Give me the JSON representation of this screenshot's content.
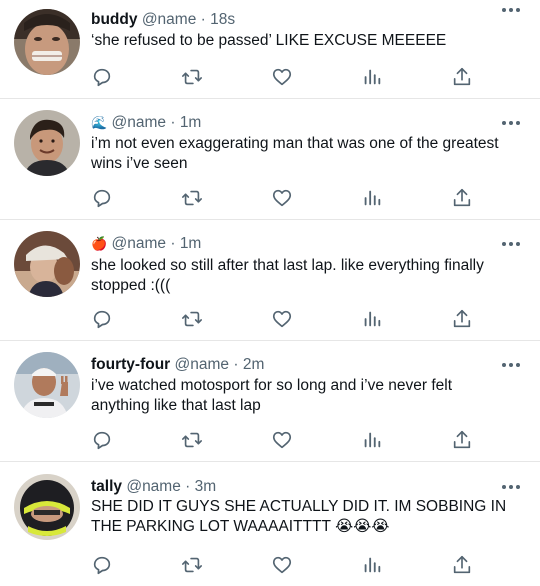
{
  "tweets": [
    {
      "name": "buddy",
      "flag": "",
      "handle": "@name",
      "dot": "·",
      "time": "18s",
      "lines": [
        "‘she refused to be passed’ LIKE EXCUSE MEEEEE"
      ],
      "avatar": "avatar-grimace"
    },
    {
      "name": "",
      "flag": "🌊",
      "handle": "@name",
      "dot": "·",
      "time": "1m",
      "lines": [
        "i’m not even exaggerating man that was one of the greatest",
        "wins i’ve seen"
      ],
      "avatar": "avatar-smiling-man"
    },
    {
      "name": "",
      "flag": "🍎",
      "handle": "@name",
      "dot": "·",
      "time": "1m",
      "lines": [
        "she looked so still after that last lap. like everything finally",
        "stopped :((("
      ],
      "avatar": "avatar-cap"
    },
    {
      "name": "fourty-four",
      "flag": "",
      "handle": "@name",
      "dot": "·",
      "time": "2m",
      "lines": [
        "i’ve watched motosport for so long and i’ve never felt",
        "anything like that last lap"
      ],
      "avatar": "avatar-peace-sign"
    },
    {
      "name": "tally",
      "flag": "",
      "handle": "@name",
      "dot": "·",
      "time": "3m",
      "lines": [
        "SHE DID IT GUYS SHE ACTUALLY DID IT. IM SOBBING IN",
        "THE PARKING LOT WAAAAITTTT 😭😭😭"
      ],
      "avatar": "avatar-helmet"
    }
  ],
  "icons": {
    "reply": "reply-icon",
    "retweet": "retweet-icon",
    "like": "heart-icon",
    "stats": "stats-icon",
    "share": "share-icon",
    "more": "more-icon"
  },
  "colors": {
    "text": "#0f1419",
    "secondary": "#536471",
    "divider": "#e6e6e6"
  }
}
